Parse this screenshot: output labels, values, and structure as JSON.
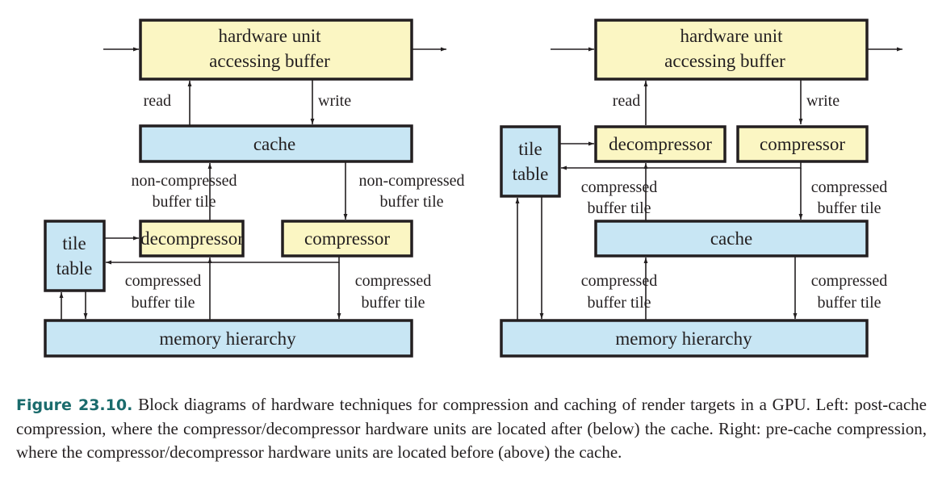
{
  "left": {
    "hw_unit": [
      "hardware unit",
      "accessing buffer"
    ],
    "read": "read",
    "write": "write",
    "cache": "cache",
    "noncomp_left": [
      "non-compressed",
      "buffer tile"
    ],
    "noncomp_right": [
      "non-compressed",
      "buffer tile"
    ],
    "tile_table": [
      "tile",
      "table"
    ],
    "decompressor": "decompressor",
    "compressor": "compressor",
    "comp_left": [
      "compressed",
      "buffer tile"
    ],
    "comp_right": [
      "compressed",
      "buffer tile"
    ],
    "memory": "memory hierarchy"
  },
  "right": {
    "hw_unit": [
      "hardware unit",
      "accessing buffer"
    ],
    "read": "read",
    "write": "write",
    "tile_table": [
      "tile",
      "table"
    ],
    "decompressor": "decompressor",
    "compressor": "compressor",
    "comp_upper_left": [
      "compressed",
      "buffer tile"
    ],
    "comp_upper_right": [
      "compressed",
      "buffer tile"
    ],
    "cache": "cache",
    "comp_lower_left": [
      "compressed",
      "buffer tile"
    ],
    "comp_lower_right": [
      "compressed",
      "buffer tile"
    ],
    "memory": "memory hierarchy"
  },
  "caption": {
    "label": "Figure 23.10.",
    "text": "Block diagrams of hardware techniques for compression and caching of render targets in a GPU. Left: post-cache compression, where the compressor/decompressor hardware units are located after (below) the cache. Right: pre-cache compression, where the compressor/decompressor hardware units are located before (above) the cache."
  },
  "colors": {
    "yellow_box": "#fbf6c3",
    "blue_box": "#c8e6f4",
    "label": "#1a6b6c"
  }
}
